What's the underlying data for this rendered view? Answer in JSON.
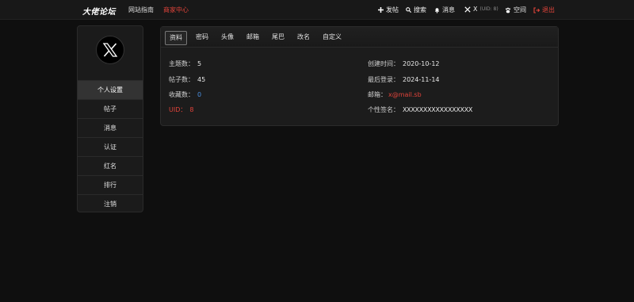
{
  "header": {
    "logo": "大佬论坛",
    "nav": [
      "网站指南",
      "商家中心"
    ],
    "post_label": "发帖",
    "search_label": "搜索",
    "messages_label": "消息",
    "user_name": "X",
    "user_uid": "(UID: 8)",
    "space_label": "空间",
    "logout_label": "退出",
    "accent_color": "#e0433a"
  },
  "sidebar": {
    "avatar_glyph": "𝕏",
    "username": "X",
    "items": [
      {
        "label": "个人设置",
        "active": true
      },
      {
        "label": "帖子"
      },
      {
        "label": "消息"
      },
      {
        "label": "认证"
      },
      {
        "label": "红名"
      },
      {
        "label": "排行"
      },
      {
        "label": "注销"
      }
    ]
  },
  "tabs": [
    "资料",
    "密码",
    "头像",
    "邮箱",
    "尾巴",
    "改名",
    "自定义"
  ],
  "profile": {
    "topics_label": "主题数：",
    "topics_value": "5",
    "posts_label": "帖子数：",
    "posts_value": "45",
    "favorites_label": "收藏数：",
    "favorites_value": "0",
    "uid_label": "UID：",
    "uid_value": "8",
    "created_label": "创建时间：",
    "created_value": "2020-10-12",
    "lastlogin_label": "最后登录：",
    "lastlogin_value": "2024-11-14",
    "email_label": "邮箱：",
    "email_value": "x@mail.sb",
    "signature_label": "个性签名：",
    "signature_value": "XXXXXXXXXXXXXXXXX"
  }
}
